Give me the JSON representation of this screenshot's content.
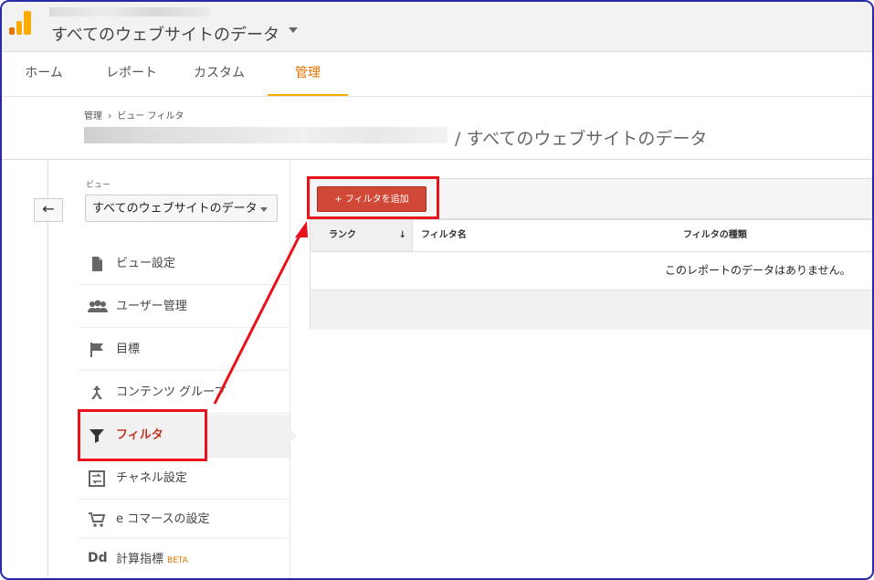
{
  "header": {
    "view_title": "すべてのウェブサイトのデータ"
  },
  "nav": {
    "tabs": [
      {
        "label": "ホーム"
      },
      {
        "label": "レポート"
      },
      {
        "label": "カスタム"
      },
      {
        "label": "管理"
      }
    ],
    "active_tab": "管理"
  },
  "breadcrumb": {
    "parent": "管理",
    "separator": "›",
    "current": "ビュー フィルタ"
  },
  "page": {
    "title": "/ すべてのウェブサイトのデータ"
  },
  "sidebar": {
    "back_icon": "back-arrow-icon",
    "view_label": "ビュー",
    "view_selected": "すべてのウェブサイトのデータ",
    "items": [
      {
        "label": "ビュー設定",
        "icon": "document-icon"
      },
      {
        "label": "ユーザー管理",
        "icon": "users-icon"
      },
      {
        "label": "目標",
        "icon": "flag-icon"
      },
      {
        "label": "コンテンツ グループ",
        "icon": "content-grouping-icon"
      },
      {
        "label": "フィルタ",
        "icon": "filter-icon"
      },
      {
        "label": "チャネル設定",
        "icon": "channel-settings-icon"
      },
      {
        "label": "e コマースの設定",
        "icon": "cart-icon"
      },
      {
        "label": "計算指標",
        "icon": "dd-icon",
        "icon_text": "Dd",
        "badge": "BETA"
      }
    ],
    "active_item": "フィルタ"
  },
  "filters": {
    "add_button": "+ フィルタを追加",
    "columns": [
      "ランク",
      "フィルタ名",
      "フィルタの種類"
    ],
    "empty_message": "このレポートのデータはありません。"
  },
  "colors": {
    "accent": "#e37400",
    "active_label": "#c23321",
    "add_button": "#d14836",
    "annotation": "#e8121d"
  }
}
